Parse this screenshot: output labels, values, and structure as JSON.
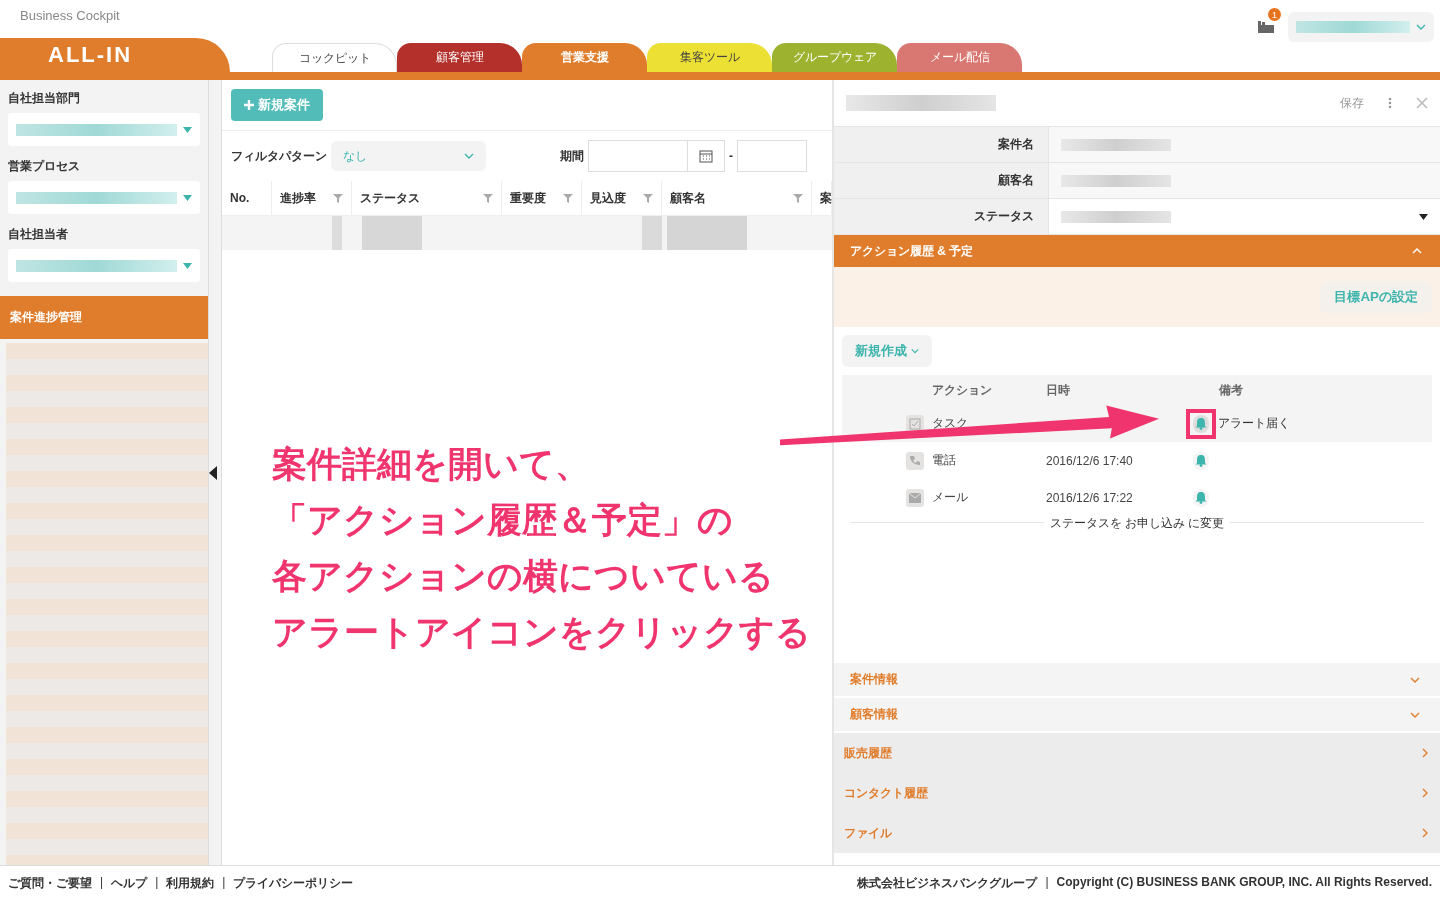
{
  "app": {
    "title": "Business Cockpit",
    "logo": "ALL-IN",
    "notification_count": "1"
  },
  "tabs": [
    {
      "label": "コックピット",
      "selected": false,
      "color": "#ffffff"
    },
    {
      "label": "顧客管理",
      "selected": false,
      "color": "#b3302b"
    },
    {
      "label": "営業支援",
      "selected": true,
      "color": "#e07d2c"
    },
    {
      "label": "集客ツール",
      "selected": false,
      "color": "#ece034"
    },
    {
      "label": "グループウェア",
      "selected": false,
      "color": "#9db22f"
    },
    {
      "label": "メール配信",
      "selected": false,
      "color": "#d97872"
    }
  ],
  "sidebar": {
    "filters": [
      {
        "label": "自社担当部門"
      },
      {
        "label": "営業プロセス"
      },
      {
        "label": "自社担当者"
      }
    ],
    "section": "案件進捗管理"
  },
  "list": {
    "new_button": "新規案件",
    "filter_label": "フィルタパターン",
    "filter_value": "なし",
    "period_label": "期間",
    "period_separator": "-",
    "columns": [
      {
        "label": "No.",
        "filter": false
      },
      {
        "label": "進捗率",
        "filter": true
      },
      {
        "label": "ステータス",
        "filter": true
      },
      {
        "label": "重要度",
        "filter": true
      },
      {
        "label": "見込度",
        "filter": true
      },
      {
        "label": "顧客名",
        "filter": true
      },
      {
        "label": "案"
      }
    ]
  },
  "detail": {
    "save": "保存",
    "fields": [
      {
        "label": "案件名",
        "kind": "text"
      },
      {
        "label": "顧客名",
        "kind": "text"
      },
      {
        "label": "ステータス",
        "kind": "select"
      }
    ],
    "action_section": {
      "title": "アクション履歴 & 予定",
      "expanded": true,
      "goal_button": "目標APの設定",
      "new_button": "新規作成",
      "columns": [
        "アクション",
        "日時",
        "備考"
      ],
      "rows": [
        {
          "kind": "task",
          "action": "タスク",
          "date": "",
          "note": "アラート届く",
          "selected": true,
          "highlighted": true
        },
        {
          "kind": "phone",
          "action": "電話",
          "date": "2016/12/6 17:40",
          "note": "",
          "selected": false,
          "highlighted": false
        },
        {
          "kind": "mail",
          "action": "メール",
          "date": "2016/12/6 17:22",
          "note": "",
          "selected": false,
          "highlighted": false
        }
      ],
      "status_change": "ステータスを お申し込み に変更"
    },
    "sections": [
      {
        "title": "案件情報",
        "kind": "accordion"
      },
      {
        "title": "顧客情報",
        "kind": "accordion"
      },
      {
        "title": "販売履歴",
        "kind": "link"
      },
      {
        "title": "コンタクト履歴",
        "kind": "link"
      },
      {
        "title": "ファイル",
        "kind": "link"
      }
    ]
  },
  "annotation": {
    "lines": [
      "案件詳細を開いて、",
      "「アクション履歴＆予定」の",
      "各アクションの横についている",
      "アラートアイコンをクリックする"
    ]
  },
  "footer": {
    "links": [
      "ご質問・ご要望",
      "ヘルプ",
      "利用規約",
      "プライバシーポリシー"
    ],
    "separator": "|",
    "company": "株式会社ビジネスバンクグループ",
    "copyright": "Copyright (C) BUSINESS BANK GROUP, INC. All Rights Reserved."
  }
}
